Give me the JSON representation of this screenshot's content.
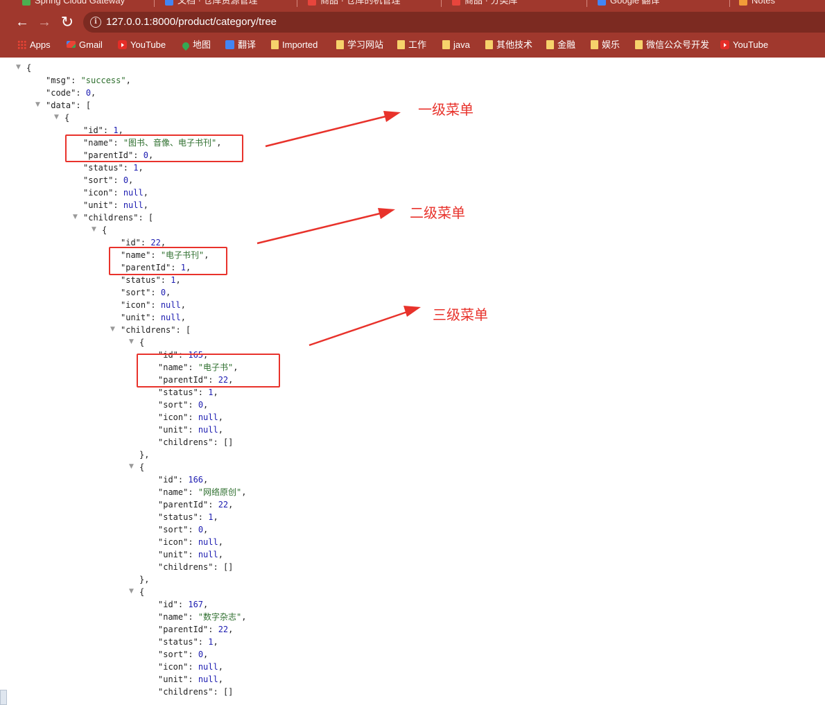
{
  "tabs": [
    {
      "label": "Spring Cloud Gateway",
      "color": "#4caf50"
    },
    {
      "label": "文档 · 仓库资源管理",
      "color": "#4285f4"
    },
    {
      "label": "商品 · 仓库的机管理",
      "color": "#e8453c"
    },
    {
      "label": "商品 · 分类库",
      "color": "#e8453c"
    },
    {
      "label": "Google 翻译",
      "color": "#4285f4"
    },
    {
      "label": "Notes",
      "color": "#f29b38"
    }
  ],
  "nav": {
    "back": "←",
    "forward": "→",
    "reload": "↻",
    "info": "i",
    "url": "127.0.0.1:8000/product/category/tree"
  },
  "bookmarks": [
    {
      "label": "Apps",
      "icon": "apps-grid-icon"
    },
    {
      "label": "Gmail",
      "icon": "gmail-icon"
    },
    {
      "label": "YouTube",
      "icon": "youtube-icon"
    },
    {
      "label": "地图",
      "icon": "maps-icon"
    },
    {
      "label": "翻译",
      "icon": "translate-icon"
    },
    {
      "label": "Imported",
      "icon": "folder-icon"
    },
    {
      "label": "学习网站",
      "icon": "folder-icon"
    },
    {
      "label": "工作",
      "icon": "folder-icon"
    },
    {
      "label": "java",
      "icon": "folder-icon"
    },
    {
      "label": "其他技术",
      "icon": "folder-icon"
    },
    {
      "label": "金融",
      "icon": "folder-icon"
    },
    {
      "label": "娱乐",
      "icon": "folder-icon"
    },
    {
      "label": "微信公众号开发",
      "icon": "folder-icon"
    },
    {
      "label": "YouTube",
      "icon": "youtube-icon"
    }
  ],
  "json": {
    "open_brace": "{",
    "msg_key": "\"msg\"",
    "msg_val": "\"success\"",
    "code_key": "\"code\"",
    "code_val": "0",
    "data_key": "\"data\"",
    "data_open": "[",
    "item_open": "{",
    "c1": {
      "id": "1",
      "name": "\"图书、音像、电子书刊\"",
      "parentId": "0",
      "status": "1",
      "sort": "0",
      "icon": "null",
      "unit": "null"
    },
    "c2": {
      "id": "22",
      "name": "\"电子书刊\"",
      "parentId": "1",
      "status": "1",
      "sort": "0",
      "icon": "null",
      "unit": "null"
    },
    "c3": [
      {
        "id": "165",
        "name": "\"电子书\"",
        "parentId": "22",
        "status": "1",
        "sort": "0",
        "icon": "null",
        "unit": "null",
        "childrens": "[]"
      },
      {
        "id": "166",
        "name": "\"网络原创\"",
        "parentId": "22",
        "status": "1",
        "sort": "0",
        "icon": "null",
        "unit": "null",
        "childrens": "[]"
      },
      {
        "id": "167",
        "name": "\"数字杂志\"",
        "parentId": "22",
        "status": "1",
        "sort": "0",
        "icon": "null",
        "unit": "null",
        "childrens": "[]"
      }
    ],
    "keys": {
      "id": "\"id\"",
      "name": "\"name\"",
      "parentId": "\"parentId\"",
      "status": "\"status\"",
      "sort": "\"sort\"",
      "icon": "\"icon\"",
      "unit": "\"unit\"",
      "childrens": "\"childrens\""
    },
    "close_obj": "},"
  },
  "annotations": {
    "level1": "一级菜单",
    "level2": "二级菜单",
    "level3": "三级菜单",
    "color": "#e8322b"
  }
}
